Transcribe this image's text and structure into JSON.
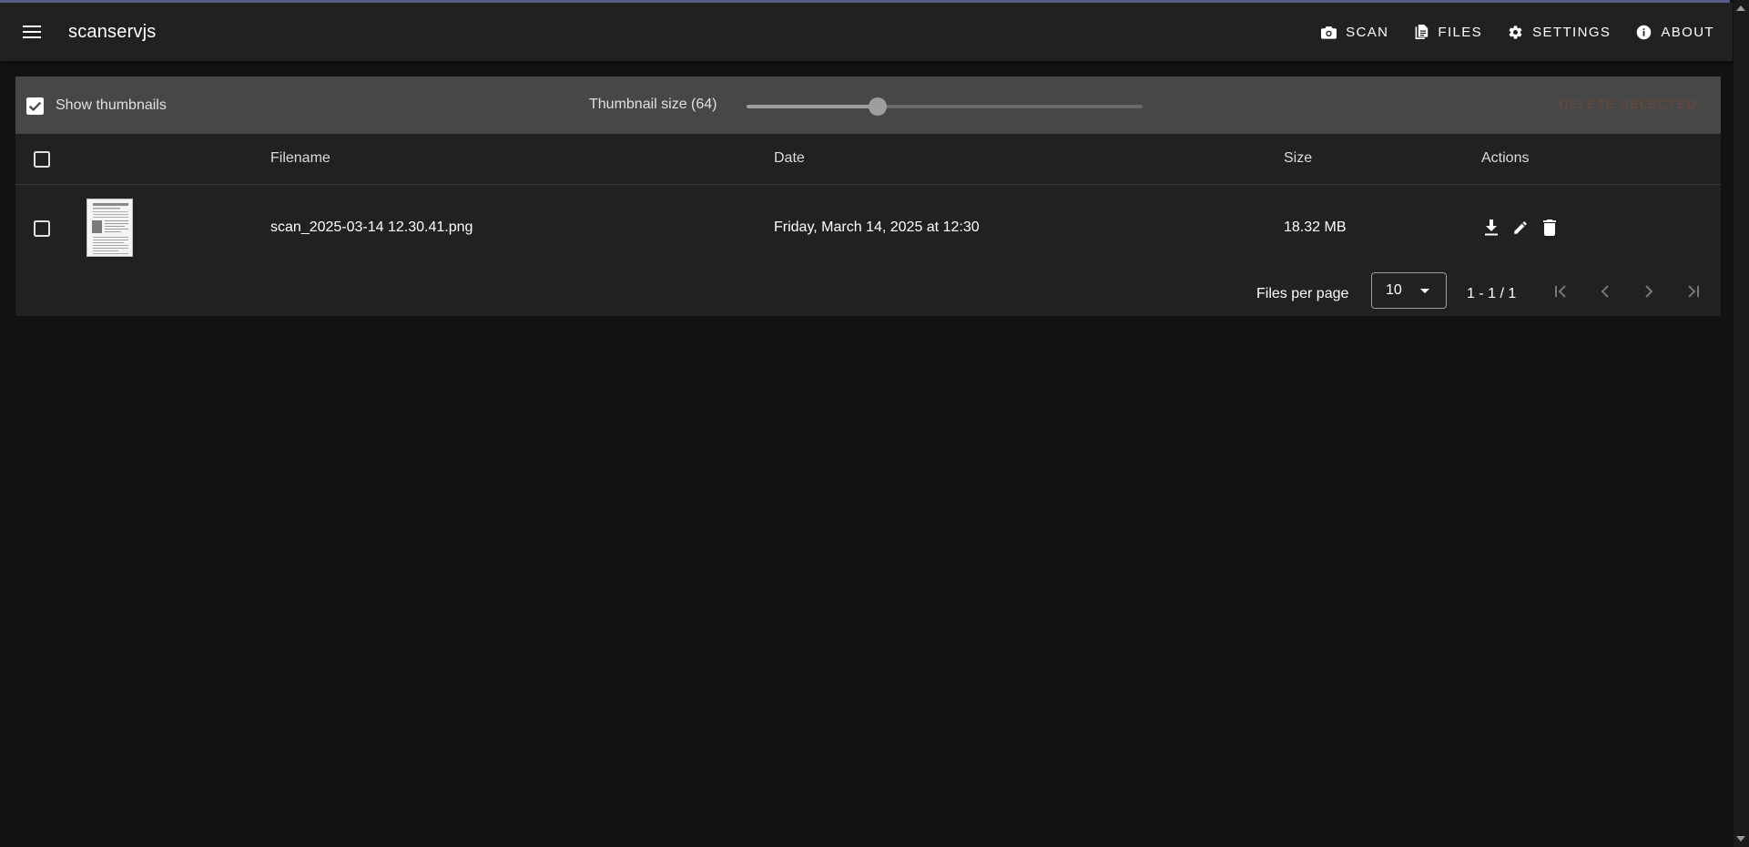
{
  "app": {
    "title": "scanservjs"
  },
  "nav": {
    "menu_icon": "hamburger-menu-icon",
    "items": [
      {
        "label": "Scan",
        "icon": "camera-icon"
      },
      {
        "label": "Files",
        "icon": "files-icon"
      },
      {
        "label": "Settings",
        "icon": "gear-icon"
      },
      {
        "label": "About",
        "icon": "info-icon"
      }
    ]
  },
  "toolbar": {
    "show_thumbnails_label": "Show thumbnails",
    "show_thumbnails_checked": true,
    "thumbnail_size_label": "Thumbnail size (64)",
    "thumbnail_size_fraction": 0.33,
    "delete_selected_label": "Delete selected"
  },
  "table": {
    "headers": {
      "filename": "Filename",
      "date": "Date",
      "size": "Size",
      "actions": "Actions"
    },
    "rows": [
      {
        "filename": "scan_2025-03-14 12.30.41.png",
        "date": "Friday, March 14, 2025 at 12:30",
        "size": "18.32 MB",
        "actions": [
          "download-icon",
          "pencil-icon",
          "trash-icon"
        ]
      }
    ]
  },
  "pagination": {
    "per_page_label": "Files per page",
    "per_page_value": "10",
    "range_label": "1 - 1 / 1"
  },
  "colors": {
    "appbar": "#212121",
    "toolbar": "#474747",
    "table": "#212121",
    "background": "#121212",
    "delete_disabled": "#6b4a3a"
  }
}
